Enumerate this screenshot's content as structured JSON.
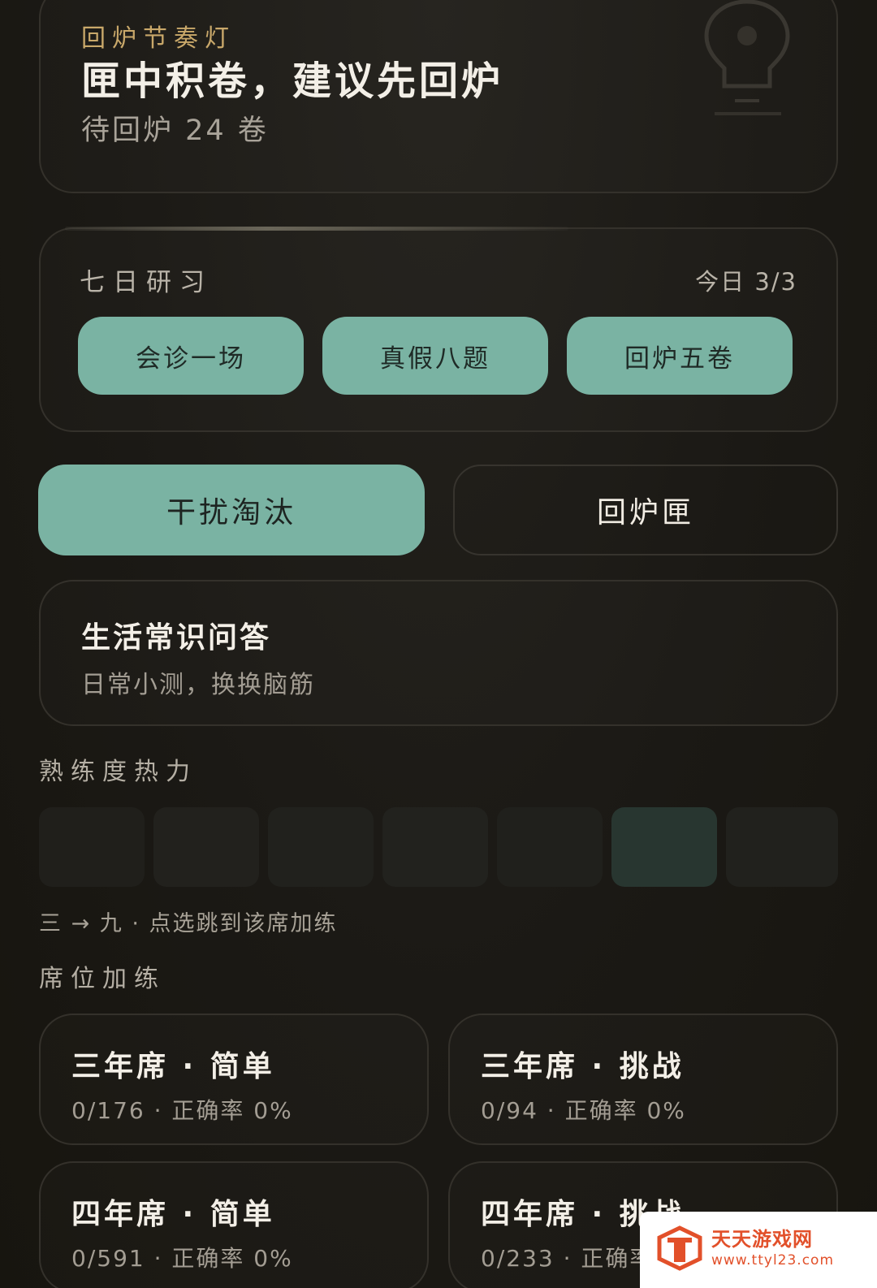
{
  "banner": {
    "eyebrow": "回炉节奏灯",
    "headline": "匣中积卷，建议先回炉",
    "subtitle": "待回炉 24 卷",
    "icon": "lightbulb-icon"
  },
  "weekly": {
    "title": "七日研习",
    "progress": "今日 3/3",
    "tasks": [
      {
        "label": "会诊一场"
      },
      {
        "label": "真假八题"
      },
      {
        "label": "回炉五卷"
      }
    ]
  },
  "modes": {
    "active": "干扰淘汰",
    "other": "回炉匣"
  },
  "category": {
    "name": "生活常识问答",
    "description": "日常小测，换换脑筋"
  },
  "heat": {
    "label": "熟练度热力",
    "highlight_index": 5,
    "cell_count": 7,
    "hint": "三 → 九 · 点选跳到该席加练"
  },
  "seats": {
    "label": "席位加练",
    "items": [
      {
        "title": "三年席 · 简单",
        "stats": "0/176 · 正确率 0%"
      },
      {
        "title": "三年席 · 挑战",
        "stats": "0/94 · 正确率 0%"
      },
      {
        "title": "四年席 · 简单",
        "stats": "0/591 · 正确率 0%"
      },
      {
        "title": "四年席 · 挑战",
        "stats": "0/233 · 正确率 0%"
      }
    ]
  },
  "watermark": {
    "name": "天天游戏网",
    "url": "www.ttyl23.com"
  },
  "colors": {
    "accent": "#7ab3a3",
    "gold": "#c9a86a",
    "background": "#1c1a16"
  }
}
